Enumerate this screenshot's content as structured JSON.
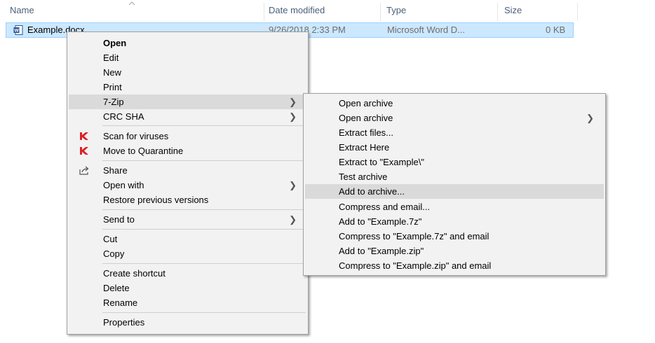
{
  "columns": {
    "name": "Name",
    "date_modified": "Date modified",
    "type": "Type",
    "size": "Size"
  },
  "file": {
    "name": "Example.docx",
    "date": "9/26/2018 2:33 PM",
    "type": "Microsoft Word D...",
    "size": "0 KB",
    "icon": "word-document-icon"
  },
  "context_menu": {
    "items": [
      {
        "label": "Open"
      },
      {
        "label": "Edit"
      },
      {
        "label": "New"
      },
      {
        "label": "Print"
      },
      {
        "label": "7-Zip"
      },
      {
        "label": "CRC SHA"
      },
      {
        "label": "Scan for viruses",
        "icon": "kaspersky-icon"
      },
      {
        "label": "Move to Quarantine",
        "icon": "kaspersky-icon"
      },
      {
        "label": "Share",
        "icon": "share-icon"
      },
      {
        "label": "Open with"
      },
      {
        "label": "Restore previous versions"
      },
      {
        "label": "Send to"
      },
      {
        "label": "Cut"
      },
      {
        "label": "Copy"
      },
      {
        "label": "Create shortcut"
      },
      {
        "label": "Delete"
      },
      {
        "label": "Rename"
      },
      {
        "label": "Properties"
      }
    ]
  },
  "submenu_7zip": {
    "items": [
      {
        "label": "Open archive"
      },
      {
        "label": "Open archive"
      },
      {
        "label": "Extract files..."
      },
      {
        "label": "Extract Here"
      },
      {
        "label": "Extract to \"Example\\\""
      },
      {
        "label": "Test archive"
      },
      {
        "label": "Add to archive..."
      },
      {
        "label": "Compress and email..."
      },
      {
        "label": "Add to \"Example.7z\""
      },
      {
        "label": "Compress to \"Example.7z\" and email"
      },
      {
        "label": "Add to \"Example.zip\""
      },
      {
        "label": "Compress to \"Example.zip\" and email"
      }
    ]
  },
  "colors": {
    "selection": "#cce8ff",
    "menu_bg": "#f2f2f2",
    "menu_highlight": "#dadada",
    "header_text": "#4c607a"
  }
}
